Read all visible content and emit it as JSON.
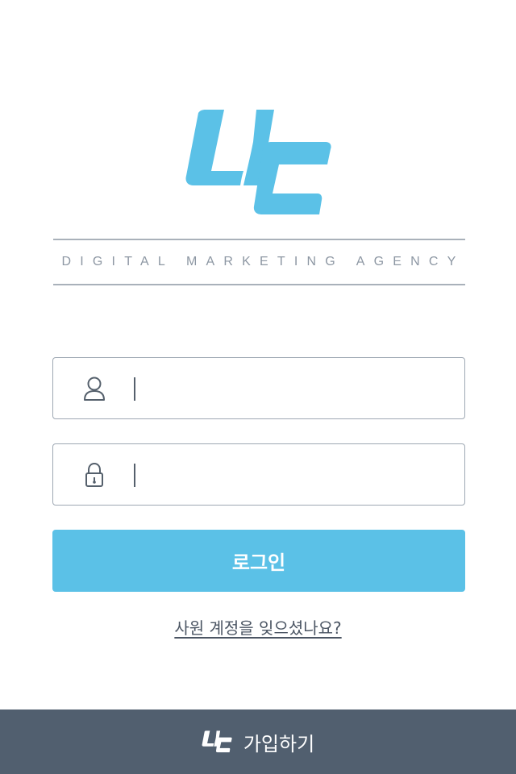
{
  "brand": {
    "logo_icon": "uc-logo-icon",
    "accent_color": "#5bc1e7",
    "tagline": "DIGITAL MARKETING AGENCY"
  },
  "login_form": {
    "username_field": {
      "icon": "user-icon",
      "value": ""
    },
    "password_field": {
      "icon": "lock-icon",
      "value": ""
    },
    "login_label": "로그인",
    "forgot_label": "사원 계정을 잊으셨나요?"
  },
  "footer": {
    "logo_icon": "uc-logo-icon",
    "signup_label": "가입하기",
    "background_color": "#515f6f"
  }
}
